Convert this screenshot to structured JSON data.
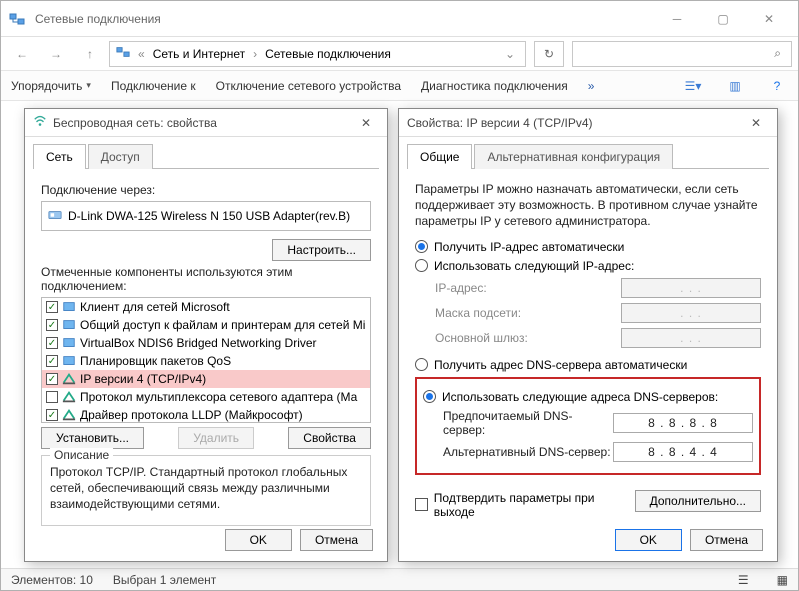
{
  "main": {
    "title": "Сетевые подключения",
    "breadcrumb1": "Сеть и Интернет",
    "breadcrumb2": "Сетевые подключения",
    "cmd_organize": "Упорядочить",
    "cmd_connect": "Подключение к",
    "cmd_disable": "Отключение сетевого устройства",
    "cmd_diag": "Диагностика подключения",
    "status_count": "Элементов: 10",
    "status_sel": "Выбран 1 элемент"
  },
  "dlg1": {
    "title": "Беспроводная сеть: свойства",
    "tab_net": "Сеть",
    "tab_access": "Доступ",
    "connect_via": "Подключение через:",
    "adapter": "D-Link DWA-125 Wireless N 150 USB Adapter(rev.B)",
    "configure": "Настроить...",
    "components_label": "Отмеченные компоненты используются этим подключением:",
    "items": [
      "Клиент для сетей Microsoft",
      "Общий доступ к файлам и принтерам для сетей Mi",
      "VirtualBox NDIS6 Bridged Networking Driver",
      "Планировщик пакетов QoS",
      "IP версии 4 (TCP/IPv4)",
      "Протокол мультиплексора сетевого адаптера (Ма",
      "Драйвер протокола LLDP (Майкрософт)"
    ],
    "install": "Установить...",
    "remove": "Удалить",
    "props": "Свойства",
    "desc_title": "Описание",
    "desc": "Протокол TCP/IP. Стандартный протокол глобальных сетей, обеспечивающий связь между различными взаимодействующими сетями.",
    "ok": "OK",
    "cancel": "Отмена"
  },
  "dlg2": {
    "title": "Свойства: IP версии 4 (TCP/IPv4)",
    "tab_general": "Общие",
    "tab_alt": "Альтернативная конфигурация",
    "desc": "Параметры IP можно назначать автоматически, если сеть поддерживает эту возможность. В противном случае узнайте параметры IP у сетевого администратора.",
    "ip_auto": "Получить IP-адрес автоматически",
    "ip_manual": "Использовать следующий IP-адрес:",
    "ip_label": "IP-адрес:",
    "mask_label": "Маска подсети:",
    "gw_label": "Основной шлюз:",
    "dns_auto": "Получить адрес DNS-сервера автоматически",
    "dns_manual": "Использовать следующие адреса DNS-серверов:",
    "dns_pref": "Предпочитаемый DNS-сервер:",
    "dns_alt": "Альтернативный DNS-сервер:",
    "dns1": "8 . 8 . 8 . 8",
    "dns2": "8 . 8 . 4 . 4",
    "confirm": "Подтвердить параметры при выходе",
    "advanced": "Дополнительно...",
    "ok": "OK",
    "cancel": "Отмена",
    "dots": ".   .   ."
  }
}
